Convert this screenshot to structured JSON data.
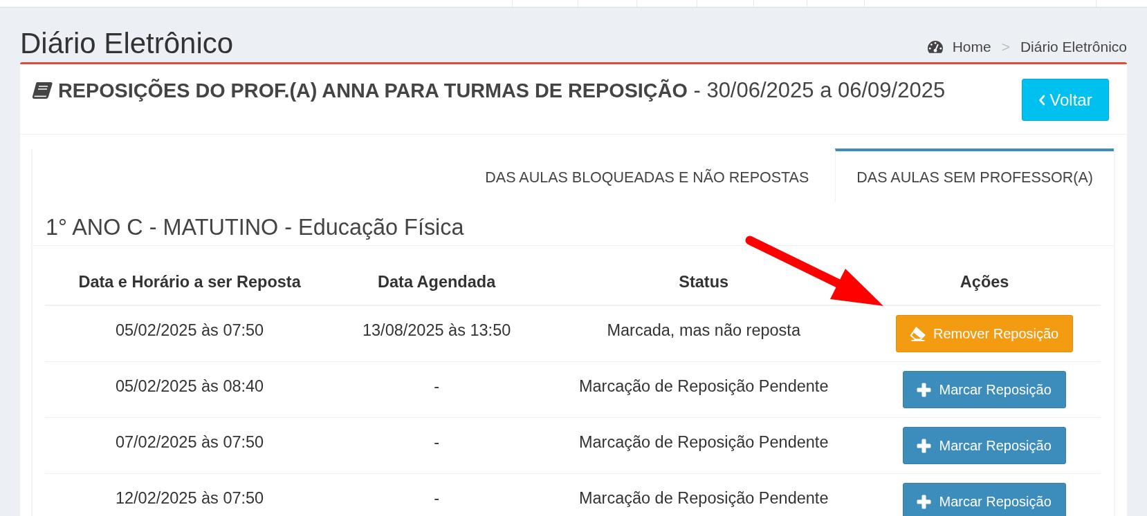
{
  "page_header": {
    "title": "Diário Eletrônico",
    "breadcrumb": {
      "separator": ">",
      "items": [
        {
          "label": "Home",
          "kind": "home"
        },
        {
          "label": "Diário Eletrônico",
          "kind": "current"
        }
      ]
    }
  },
  "box": {
    "title": "**REPOSIÇÕES DO PROF.(A) ANNA PARA TURMAS DE REPOSIÇÃO** - 30/06/2025 a 06/09/2025",
    "back_button": "Voltar"
  },
  "tabs": [
    {
      "label": "DAS AULAS BLOQUEADAS E NÃO REPOSTAS",
      "selected": false
    },
    {
      "label": "DAS AULAS SEM PROFESSOR(A)",
      "selected": true
    }
  ],
  "section": {
    "title": "1° ANO C - MATUTINO - Educação Física"
  },
  "table": {
    "columns": [
      "Data e Horário a ser Reposta",
      "Data Agendada",
      "Status",
      "Ações"
    ],
    "rows": [
      {
        "cells": [
          "05/02/2025 às 07:50",
          "13/08/2025 às 13:50",
          "Marcada, mas não reposta"
        ],
        "action": {
          "kind": "remove",
          "label": "Remover Reposição"
        }
      },
      {
        "cells": [
          "05/02/2025 às 08:40",
          "-",
          "Marcação de Reposição Pendente"
        ],
        "action": {
          "kind": "mark",
          "label": "Marcar Reposição"
        }
      },
      {
        "cells": [
          "07/02/2025 às 07:50",
          "-",
          "Marcação de Reposição Pendente"
        ],
        "action": {
          "kind": "mark",
          "label": "Marcar Reposição"
        }
      },
      {
        "cells": [
          "12/02/2025 às 07:50",
          "-",
          "Marcação de Reposição Pendente"
        ],
        "action": {
          "kind": "mark",
          "label": "Marcar Reposição"
        }
      }
    ]
  }
}
